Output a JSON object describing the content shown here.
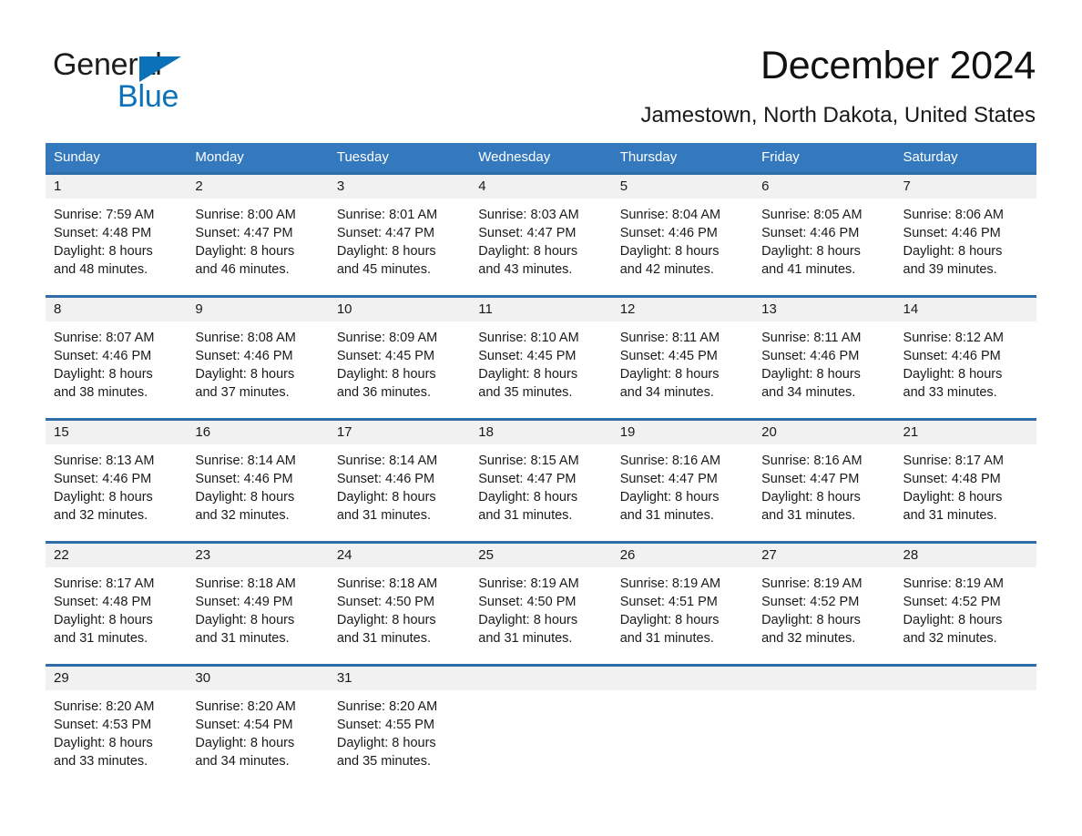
{
  "brand": {
    "word_one": "General",
    "word_two": "Blue",
    "triangle_icon": "triangle-logo-icon",
    "accent_color": "#0b72b9"
  },
  "header": {
    "title": "December 2024",
    "location": "Jamestown, North Dakota, United States"
  },
  "theme": {
    "header_blue": "#3479bd",
    "rule_blue": "#2e6da8",
    "daynum_band": "#f1f1f1",
    "text": "#1a1a1a"
  },
  "weekdays": [
    "Sunday",
    "Monday",
    "Tuesday",
    "Wednesday",
    "Thursday",
    "Friday",
    "Saturday"
  ],
  "weeks": [
    {
      "days": [
        {
          "num": "1",
          "l1": "Sunrise: 7:59 AM",
          "l2": "Sunset: 4:48 PM",
          "l3": "Daylight: 8 hours",
          "l4": "and 48 minutes."
        },
        {
          "num": "2",
          "l1": "Sunrise: 8:00 AM",
          "l2": "Sunset: 4:47 PM",
          "l3": "Daylight: 8 hours",
          "l4": "and 46 minutes."
        },
        {
          "num": "3",
          "l1": "Sunrise: 8:01 AM",
          "l2": "Sunset: 4:47 PM",
          "l3": "Daylight: 8 hours",
          "l4": "and 45 minutes."
        },
        {
          "num": "4",
          "l1": "Sunrise: 8:03 AM",
          "l2": "Sunset: 4:47 PM",
          "l3": "Daylight: 8 hours",
          "l4": "and 43 minutes."
        },
        {
          "num": "5",
          "l1": "Sunrise: 8:04 AM",
          "l2": "Sunset: 4:46 PM",
          "l3": "Daylight: 8 hours",
          "l4": "and 42 minutes."
        },
        {
          "num": "6",
          "l1": "Sunrise: 8:05 AM",
          "l2": "Sunset: 4:46 PM",
          "l3": "Daylight: 8 hours",
          "l4": "and 41 minutes."
        },
        {
          "num": "7",
          "l1": "Sunrise: 8:06 AM",
          "l2": "Sunset: 4:46 PM",
          "l3": "Daylight: 8 hours",
          "l4": "and 39 minutes."
        }
      ]
    },
    {
      "days": [
        {
          "num": "8",
          "l1": "Sunrise: 8:07 AM",
          "l2": "Sunset: 4:46 PM",
          "l3": "Daylight: 8 hours",
          "l4": "and 38 minutes."
        },
        {
          "num": "9",
          "l1": "Sunrise: 8:08 AM",
          "l2": "Sunset: 4:46 PM",
          "l3": "Daylight: 8 hours",
          "l4": "and 37 minutes."
        },
        {
          "num": "10",
          "l1": "Sunrise: 8:09 AM",
          "l2": "Sunset: 4:45 PM",
          "l3": "Daylight: 8 hours",
          "l4": "and 36 minutes."
        },
        {
          "num": "11",
          "l1": "Sunrise: 8:10 AM",
          "l2": "Sunset: 4:45 PM",
          "l3": "Daylight: 8 hours",
          "l4": "and 35 minutes."
        },
        {
          "num": "12",
          "l1": "Sunrise: 8:11 AM",
          "l2": "Sunset: 4:45 PM",
          "l3": "Daylight: 8 hours",
          "l4": "and 34 minutes."
        },
        {
          "num": "13",
          "l1": "Sunrise: 8:11 AM",
          "l2": "Sunset: 4:46 PM",
          "l3": "Daylight: 8 hours",
          "l4": "and 34 minutes."
        },
        {
          "num": "14",
          "l1": "Sunrise: 8:12 AM",
          "l2": "Sunset: 4:46 PM",
          "l3": "Daylight: 8 hours",
          "l4": "and 33 minutes."
        }
      ]
    },
    {
      "days": [
        {
          "num": "15",
          "l1": "Sunrise: 8:13 AM",
          "l2": "Sunset: 4:46 PM",
          "l3": "Daylight: 8 hours",
          "l4": "and 32 minutes."
        },
        {
          "num": "16",
          "l1": "Sunrise: 8:14 AM",
          "l2": "Sunset: 4:46 PM",
          "l3": "Daylight: 8 hours",
          "l4": "and 32 minutes."
        },
        {
          "num": "17",
          "l1": "Sunrise: 8:14 AM",
          "l2": "Sunset: 4:46 PM",
          "l3": "Daylight: 8 hours",
          "l4": "and 31 minutes."
        },
        {
          "num": "18",
          "l1": "Sunrise: 8:15 AM",
          "l2": "Sunset: 4:47 PM",
          "l3": "Daylight: 8 hours",
          "l4": "and 31 minutes."
        },
        {
          "num": "19",
          "l1": "Sunrise: 8:16 AM",
          "l2": "Sunset: 4:47 PM",
          "l3": "Daylight: 8 hours",
          "l4": "and 31 minutes."
        },
        {
          "num": "20",
          "l1": "Sunrise: 8:16 AM",
          "l2": "Sunset: 4:47 PM",
          "l3": "Daylight: 8 hours",
          "l4": "and 31 minutes."
        },
        {
          "num": "21",
          "l1": "Sunrise: 8:17 AM",
          "l2": "Sunset: 4:48 PM",
          "l3": "Daylight: 8 hours",
          "l4": "and 31 minutes."
        }
      ]
    },
    {
      "days": [
        {
          "num": "22",
          "l1": "Sunrise: 8:17 AM",
          "l2": "Sunset: 4:48 PM",
          "l3": "Daylight: 8 hours",
          "l4": "and 31 minutes."
        },
        {
          "num": "23",
          "l1": "Sunrise: 8:18 AM",
          "l2": "Sunset: 4:49 PM",
          "l3": "Daylight: 8 hours",
          "l4": "and 31 minutes."
        },
        {
          "num": "24",
          "l1": "Sunrise: 8:18 AM",
          "l2": "Sunset: 4:50 PM",
          "l3": "Daylight: 8 hours",
          "l4": "and 31 minutes."
        },
        {
          "num": "25",
          "l1": "Sunrise: 8:19 AM",
          "l2": "Sunset: 4:50 PM",
          "l3": "Daylight: 8 hours",
          "l4": "and 31 minutes."
        },
        {
          "num": "26",
          "l1": "Sunrise: 8:19 AM",
          "l2": "Sunset: 4:51 PM",
          "l3": "Daylight: 8 hours",
          "l4": "and 31 minutes."
        },
        {
          "num": "27",
          "l1": "Sunrise: 8:19 AM",
          "l2": "Sunset: 4:52 PM",
          "l3": "Daylight: 8 hours",
          "l4": "and 32 minutes."
        },
        {
          "num": "28",
          "l1": "Sunrise: 8:19 AM",
          "l2": "Sunset: 4:52 PM",
          "l3": "Daylight: 8 hours",
          "l4": "and 32 minutes."
        }
      ]
    },
    {
      "days": [
        {
          "num": "29",
          "l1": "Sunrise: 8:20 AM",
          "l2": "Sunset: 4:53 PM",
          "l3": "Daylight: 8 hours",
          "l4": "and 33 minutes."
        },
        {
          "num": "30",
          "l1": "Sunrise: 8:20 AM",
          "l2": "Sunset: 4:54 PM",
          "l3": "Daylight: 8 hours",
          "l4": "and 34 minutes."
        },
        {
          "num": "31",
          "l1": "Sunrise: 8:20 AM",
          "l2": "Sunset: 4:55 PM",
          "l3": "Daylight: 8 hours",
          "l4": "and 35 minutes."
        },
        {
          "num": "",
          "l1": "",
          "l2": "",
          "l3": "",
          "l4": ""
        },
        {
          "num": "",
          "l1": "",
          "l2": "",
          "l3": "",
          "l4": ""
        },
        {
          "num": "",
          "l1": "",
          "l2": "",
          "l3": "",
          "l4": ""
        },
        {
          "num": "",
          "l1": "",
          "l2": "",
          "l3": "",
          "l4": ""
        }
      ]
    }
  ]
}
